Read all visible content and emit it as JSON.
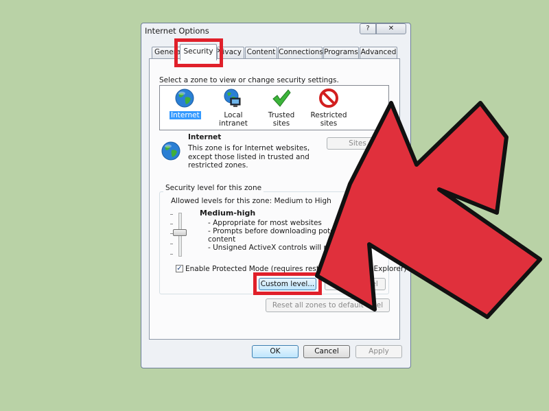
{
  "window": {
    "title": "Internet Options",
    "help_label": "?",
    "close_label": "✕"
  },
  "tabs": [
    "General",
    "Security",
    "Privacy",
    "Content",
    "Connections",
    "Programs",
    "Advanced"
  ],
  "security": {
    "zone_prompt": "Select a zone to view or change security settings.",
    "zones": [
      {
        "label": "Internet",
        "icon": "globe-icon",
        "selected": true
      },
      {
        "label": "Local intranet",
        "icon": "intranet-icon"
      },
      {
        "label": "Trusted sites",
        "icon": "checkmark-icon"
      },
      {
        "label": "Restricted\nsites",
        "icon": "no-entry-icon"
      }
    ],
    "zone_info": {
      "title": "Internet",
      "description_lines": [
        "This zone is for Internet websites,",
        "except those listed in trusted and",
        "restricted zones."
      ],
      "sites_button": "Sites"
    },
    "level_group": {
      "legend": "Security level for this zone",
      "allowed": "Allowed levels for this zone: Medium to High",
      "level_name": "Medium-high",
      "bullets": [
        "- Appropriate for most websites",
        "- Prompts before downloading potentially",
        "content",
        "- Unsigned ActiveX controls will not be"
      ],
      "protected_mode_label": "Enable Protected Mode (requires restarting Internet Explorer)",
      "protected_mode_checked": true,
      "custom_level_button": "Custom level...",
      "default_level_button": "Default level"
    },
    "reset_button": "Reset all zones to default level"
  },
  "footer": {
    "ok": "OK",
    "cancel": "Cancel",
    "apply": "Apply"
  },
  "colors": {
    "background": "#b9d2a6",
    "highlight": "#e0202a",
    "arrow_fill": "#e0303c",
    "selection": "#3399ff"
  }
}
